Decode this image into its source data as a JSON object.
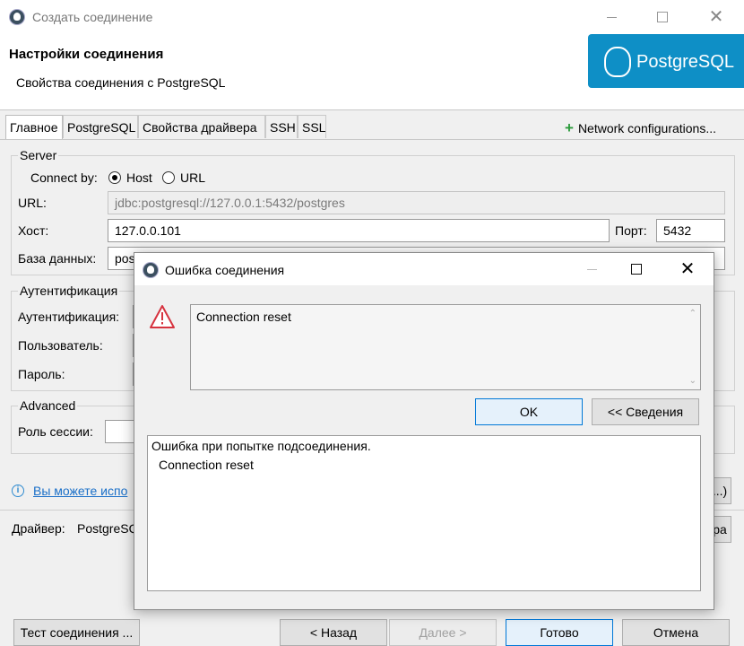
{
  "window": {
    "title": "Создать соединение",
    "header_title": "Настройки соединения",
    "header_subtitle": "Свойства соединения с PostgreSQL",
    "logo_text": "PostgreSQL",
    "logo_color": "#0e8fc6"
  },
  "tabs": [
    {
      "label": "Главное",
      "active": true
    },
    {
      "label": "PostgreSQL",
      "active": false
    },
    {
      "label": "Свойства драйвера",
      "active": false
    },
    {
      "label": "SSH",
      "active": false
    },
    {
      "label": "SSL",
      "active": false
    }
  ],
  "network_configurations": "Network configurations...",
  "server": {
    "group_label": "Server",
    "connect_by_label": "Connect by:",
    "option_host": "Host",
    "option_url": "URL",
    "selected": "Host",
    "url_label": "URL:",
    "url_value": "jdbc:postgresql://127.0.0.1:5432/postgres",
    "host_label": "Хост:",
    "host_value": "127.0.0.101",
    "port_label": "Порт:",
    "port_value": "5432",
    "db_label": "База данных:",
    "db_value_visible": "pos"
  },
  "auth": {
    "group_label": "Аутентификация",
    "auth_label": "Аутентификация:",
    "user_label": "Пользователь:",
    "password_label": "Пароль:"
  },
  "advanced": {
    "group_label": "Advanced",
    "session_role_label": "Роль сессии:"
  },
  "info_link": "Вы можете испо",
  "partial_button_right": "...)",
  "driver": {
    "label": "Драйвер:",
    "value_visible": "PostgreSQ",
    "partial_button_right": "ра"
  },
  "bottom_buttons": {
    "test": "Тест соединения ...",
    "back": "< Назад",
    "next": "Далее >",
    "finish": "Готово",
    "cancel": "Отмена"
  },
  "dialog": {
    "title": "Ошибка соединения",
    "message": "Connection reset",
    "ok": "OK",
    "details": "<< Сведения",
    "details_line1": "Ошибка при попытке подсоединения.",
    "details_line2": "Connection reset",
    "warning_color": "#d6333f"
  }
}
